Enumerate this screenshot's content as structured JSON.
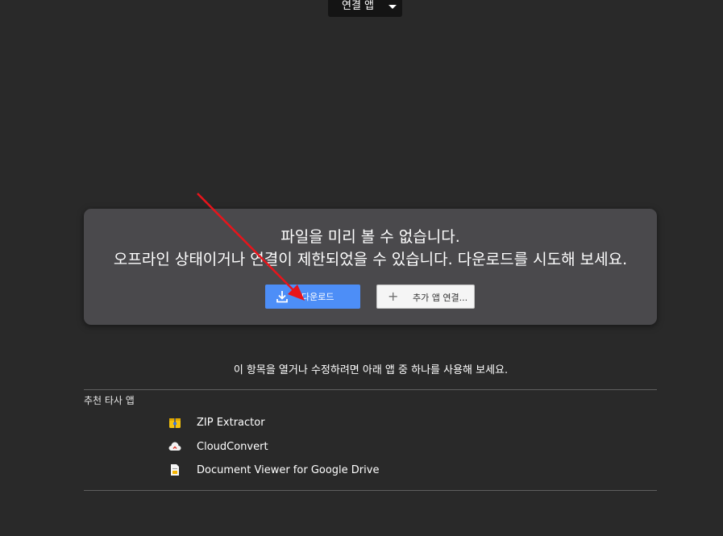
{
  "header": {
    "open_with_label": "연결 앱"
  },
  "preview_card": {
    "line1": "파일을 미리 볼 수 없습니다.",
    "line2": "오프라인 상태이거나 연결이 제한되었을 수 있습니다. 다운로드를 시도해 보세요.",
    "download_label": "다운로드",
    "connect_label": "추가 앱 연결..."
  },
  "suggestions": {
    "text": "이 항목을 열거나 수정하려면 아래 앱 중 하나를 사용해 보세요.",
    "section_title": "추천 타사 앱",
    "apps": [
      {
        "name": "ZIP Extractor",
        "icon": "zip-extractor-icon"
      },
      {
        "name": "CloudConvert",
        "icon": "cloudconvert-icon"
      },
      {
        "name": "Document Viewer for Google Drive",
        "icon": "document-viewer-icon"
      }
    ]
  },
  "colors": {
    "background": "#292929",
    "card": "#4a494c",
    "primary_button": "#4d8ef7",
    "annotation_arrow": "#e8141b"
  }
}
